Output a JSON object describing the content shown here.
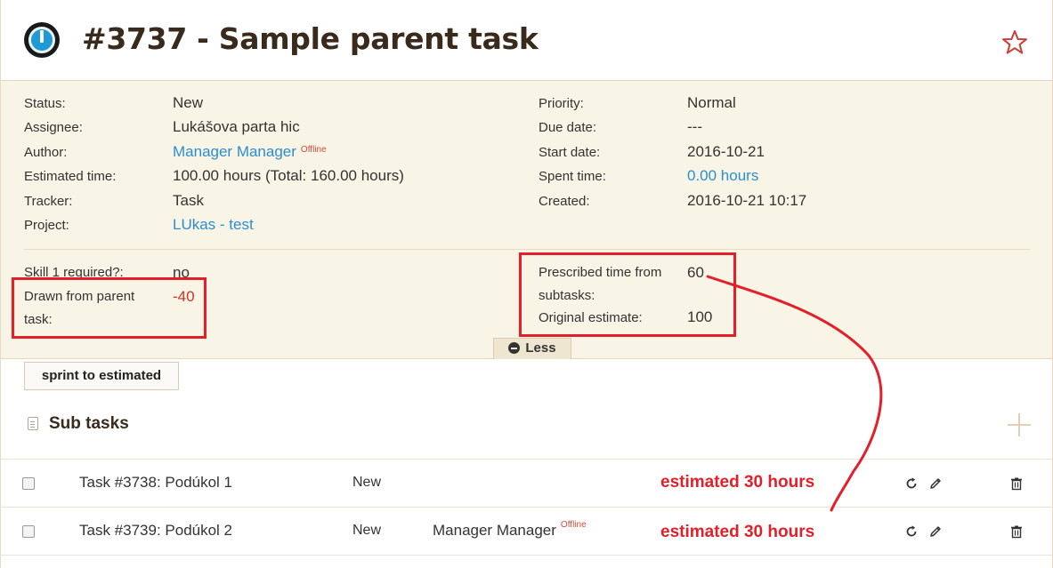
{
  "issue": {
    "title": "#3737 - Sample parent task"
  },
  "attributes": {
    "left": [
      {
        "label": "Status:",
        "value": "New"
      },
      {
        "label": "Assignee:",
        "value": "Lukášova parta hic"
      },
      {
        "label": "Author:",
        "value": "Manager Manager",
        "badge": "Offline"
      },
      {
        "label": "Estimated time:",
        "value": "100.00 hours (Total: 160.00 hours)"
      },
      {
        "label": "Tracker:",
        "value": "Task"
      },
      {
        "label": "Project:",
        "value": "LUkas - test"
      }
    ],
    "right": [
      {
        "label": "Priority:",
        "value": "Normal"
      },
      {
        "label": "Due date:",
        "value": "---"
      },
      {
        "label": "Start date:",
        "value": "2016-10-21"
      },
      {
        "label": "Spent time:",
        "value": "0.00 hours"
      },
      {
        "label": "Created:",
        "value": "2016-10-21 10:17"
      }
    ],
    "custom_left": [
      {
        "label": "Skill 1 required?:",
        "value": "no"
      },
      {
        "label_line1": "Drawn from parent",
        "label_line2": "task:",
        "value": "-40"
      }
    ],
    "custom_right": [
      {
        "label_line1": "Prescribed time from",
        "label_line2": "subtasks:",
        "value": "60"
      },
      {
        "label": "Original estimate:",
        "value": "100"
      }
    ],
    "less_label": "Less"
  },
  "actions": {
    "sprint_button": "sprint to estimated"
  },
  "subtasks": {
    "heading": "Sub tasks",
    "rows": [
      {
        "name": "Task #3738: Podúkol 1",
        "status": "New",
        "assignee": "",
        "badge": "",
        "annotation": "estimated 30 hours"
      },
      {
        "name": "Task #3739: Podúkol 2",
        "status": "New",
        "assignee": "Manager Manager",
        "badge": "Offline",
        "annotation": "estimated 30 hours"
      }
    ]
  },
  "colors": {
    "accent_link": "#2b8fcf",
    "annotation_red": "#e3202a",
    "panel_bg": "#f8f4e6"
  }
}
